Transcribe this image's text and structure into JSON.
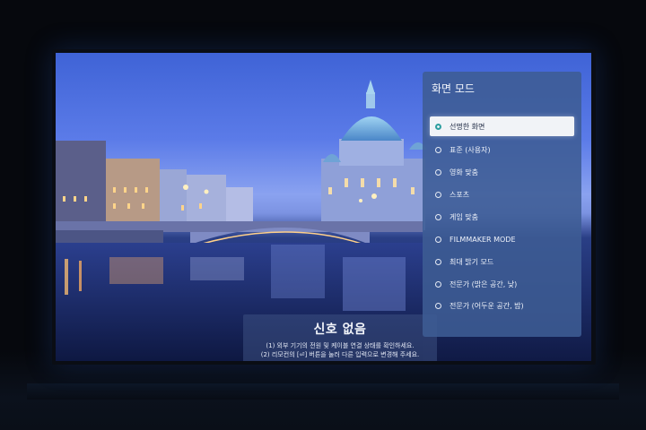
{
  "no_signal": {
    "title": "신호 없음",
    "line1": "(1) 외부 기기의 전원 및 케이블 연결 상태를 확인하세요.",
    "line2": "(2) 리모컨의 [⏎] 버튼을 눌러 다른 입력으로 변경해 주세요."
  },
  "picture_mode_menu": {
    "title": "화면 모드",
    "selected_index": 0,
    "items": [
      {
        "label": "선명한 화면"
      },
      {
        "label": "표준 (사용자)"
      },
      {
        "label": "영화 맞춤"
      },
      {
        "label": "스포츠"
      },
      {
        "label": "게임 맞춤"
      },
      {
        "label": "FILMMAKER MODE"
      },
      {
        "label": "최대 밝기 모드"
      },
      {
        "label": "전문가 (밝은 공간, 낮)"
      },
      {
        "label": "전문가 (어두운 공간, 밤)"
      }
    ]
  },
  "colors": {
    "menu_bg": "#3e5c94",
    "selected_bg": "#f1f3f7",
    "radio_accent": "#2e9fa0"
  }
}
